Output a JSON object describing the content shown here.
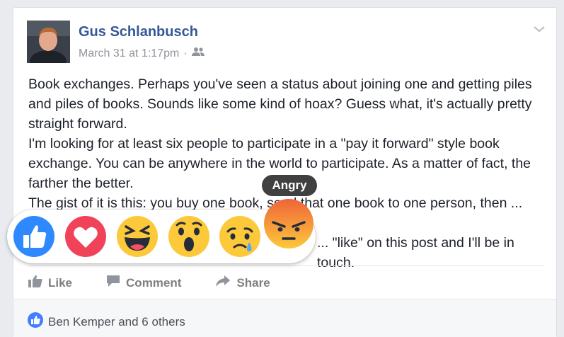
{
  "post": {
    "author": "Gus Schlanbusch",
    "timestamp": "March 31 at 1:17pm",
    "separator": "·",
    "audience_icon": "friends-icon",
    "paragraphs": [
      "Book exchanges. Perhaps you've seen a status about joining one and getting piles and piles of books. Sounds like some kind of hoax? Guess what, it's actually pretty straight forward.",
      "I'm looking for at least six people to participate in a \"pay it forward\" style book exchange. You can be anywhere in the world to participate. As a matter of fact, the farther the better.",
      "The gist of it is this: you buy one book, send that one book to one person, then ... books.",
      "... \"like\" on this post and I'll be in touch."
    ]
  },
  "reactions": {
    "items": [
      {
        "name": "like",
        "color": "#2e89ff"
      },
      {
        "name": "love",
        "color": "#f0435a"
      },
      {
        "name": "haha",
        "color": "#fcc93b"
      },
      {
        "name": "wow",
        "color": "#fcc93b"
      },
      {
        "name": "sad",
        "color": "#fcc93b"
      },
      {
        "name": "angry",
        "color": "#f0643a"
      }
    ],
    "hovered_label": "Angry"
  },
  "actions": {
    "like": "Like",
    "comment": "Comment",
    "share": "Share"
  },
  "likes_summary": {
    "text": "Ben Kemper and 6 others"
  },
  "colors": {
    "link": "#365899",
    "muted": "#90949c",
    "text": "#1d2129",
    "like_blue": "#4080ff"
  }
}
